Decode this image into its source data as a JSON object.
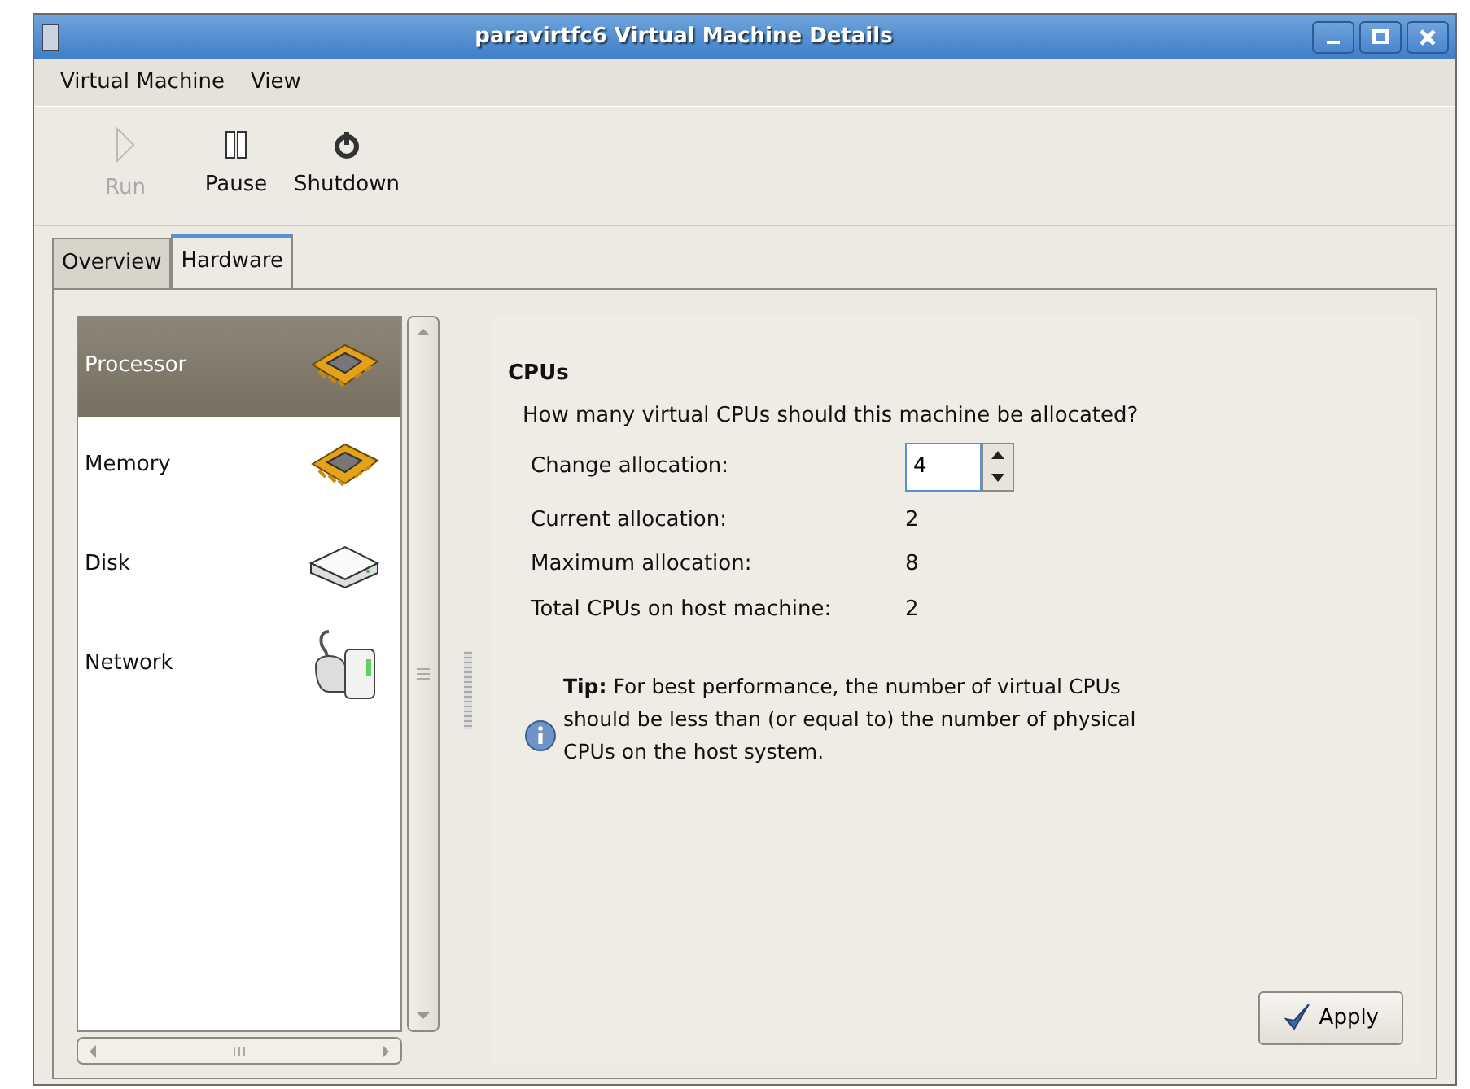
{
  "window": {
    "title": "paravirtfc6 Virtual Machine Details"
  },
  "menu": [
    {
      "label": "Virtual Machine"
    },
    {
      "label": "View"
    }
  ],
  "toolbar": [
    {
      "label": "Run",
      "kind": "run",
      "disabled": true
    },
    {
      "label": "Pause",
      "kind": "pause",
      "disabled": false
    },
    {
      "label": "Shutdown",
      "kind": "shutdown",
      "disabled": false
    }
  ],
  "tabs": [
    {
      "label": "Overview",
      "selected": false
    },
    {
      "label": "Hardware",
      "selected": true
    }
  ],
  "sidebar": {
    "items": [
      {
        "label": "Processor",
        "kind": "chip",
        "selected": true
      },
      {
        "label": "Memory",
        "kind": "chip",
        "selected": false
      },
      {
        "label": "Disk",
        "kind": "disk",
        "selected": false
      },
      {
        "label": "Network",
        "kind": "network",
        "selected": false
      }
    ]
  },
  "cpus": {
    "title": "CPUs",
    "question": "How many virtual CPUs should this machine be allocated?",
    "rows": [
      {
        "label": "Change allocation:",
        "kind": "spin",
        "value": "4"
      },
      {
        "label": "Current allocation:",
        "kind": "text",
        "value": "2"
      },
      {
        "label": "Maximum allocation:",
        "kind": "text",
        "value": "8"
      },
      {
        "label": "Total CPUs on host machine:",
        "kind": "text",
        "value": "2"
      }
    ],
    "tip": "**Tip:** For best performance, the number of virtual CPUs should be less than (or equal to) the number of physical CPUs on the host system."
  },
  "apply_button": {
    "label": "Apply"
  }
}
